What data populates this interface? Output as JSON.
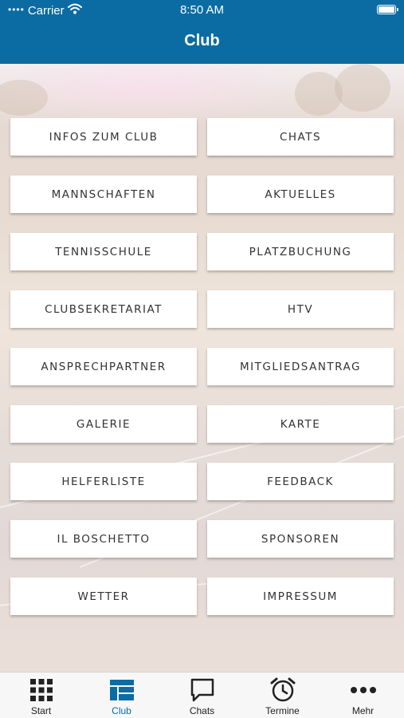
{
  "status_bar": {
    "carrier": "Carrier",
    "time": "8:50 AM"
  },
  "nav": {
    "title": "Club"
  },
  "menu": [
    "INFOS ZUM CLUB",
    "CHATS",
    "MANNSCHAFTEN",
    "AKTUELLES",
    "TENNISSCHULE",
    "PLATZBUCHUNG",
    "CLUBSEKRETARIAT",
    "HTV",
    "ANSPRECHPARTNER",
    "MITGLIEDSANTRAG",
    "GALERIE",
    "KARTE",
    "HELFERLISTE",
    "FEEDBACK",
    "IL BOSCHETTO",
    "SPONSOREN",
    "WETTER",
    "IMPRESSUM"
  ],
  "tabs": [
    {
      "label": "Start",
      "icon": "grid-icon",
      "active": false
    },
    {
      "label": "Club",
      "icon": "layout-icon",
      "active": true
    },
    {
      "label": "Chats",
      "icon": "chat-bubble-icon",
      "active": false
    },
    {
      "label": "Termine",
      "icon": "alarm-clock-icon",
      "active": false
    },
    {
      "label": "Mehr",
      "icon": "more-dots-icon",
      "active": false
    }
  ],
  "colors": {
    "brand": "#0b6ca3",
    "tab_inactive": "#222222",
    "tile_text": "#333333"
  }
}
